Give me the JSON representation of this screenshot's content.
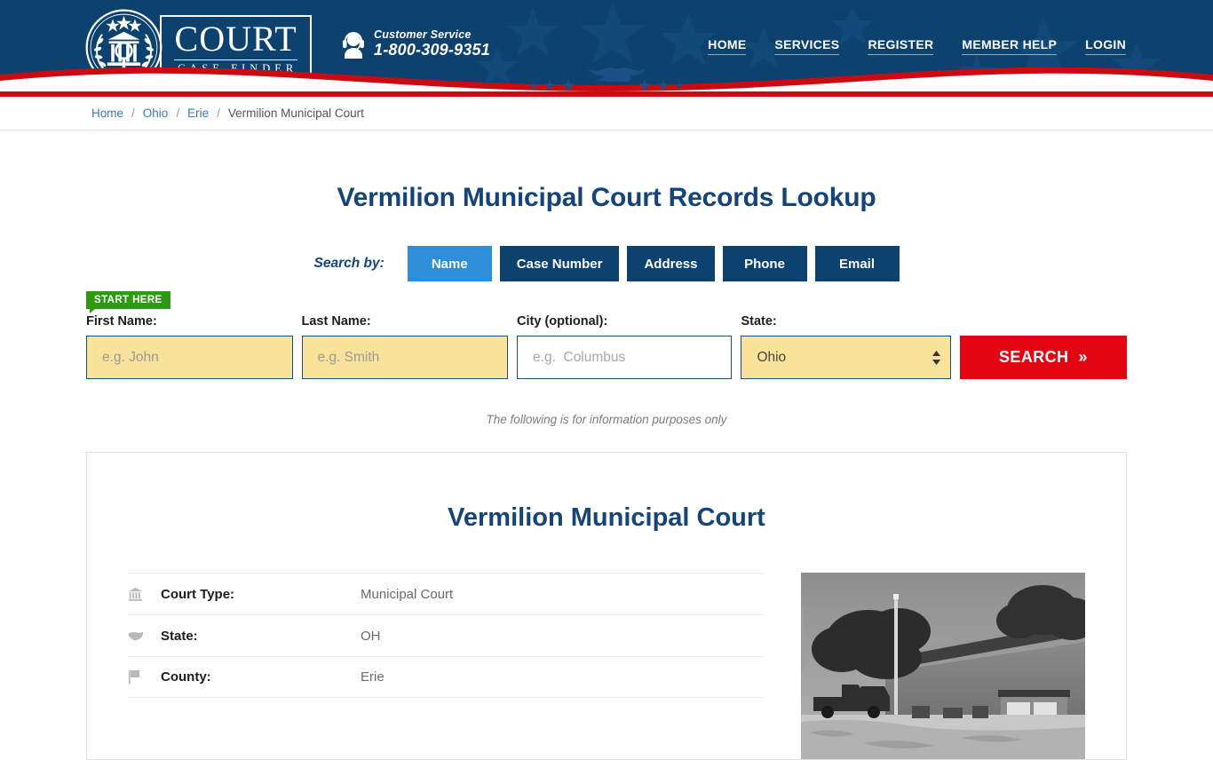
{
  "header": {
    "logo": {
      "seal_icon": "court-seal-icon",
      "title": "COURT",
      "subtitle": "CASE FINDER"
    },
    "customer_service": {
      "icon": "headset-support-icon",
      "label": "Customer Service",
      "phone": "1-800-309-9351"
    },
    "nav": [
      {
        "label": "HOME"
      },
      {
        "label": "SERVICES"
      },
      {
        "label": "REGISTER"
      },
      {
        "label": "MEMBER HELP"
      },
      {
        "label": "LOGIN"
      }
    ],
    "colors": {
      "navy": "#0d416e",
      "red": "#cc0a12",
      "accent_blue": "#2e8fd8"
    }
  },
  "breadcrumb": {
    "items": [
      {
        "label": "Home",
        "link": true
      },
      {
        "label": "Ohio",
        "link": true
      },
      {
        "label": "Erie",
        "link": true
      },
      {
        "label": "Vermilion Municipal Court",
        "link": false
      }
    ],
    "separator": "/"
  },
  "main": {
    "page_title": "Vermilion Municipal Court Records Lookup",
    "search_by_label": "Search by:",
    "tabs": [
      {
        "label": "Name",
        "active": true
      },
      {
        "label": "Case Number",
        "active": false
      },
      {
        "label": "Address",
        "active": false
      },
      {
        "label": "Phone",
        "active": false
      },
      {
        "label": "Email",
        "active": false
      }
    ],
    "start_badge": "START HERE",
    "form": {
      "first_name": {
        "label": "First Name:",
        "placeholder": "e.g. John",
        "value": ""
      },
      "last_name": {
        "label": "Last Name:",
        "placeholder": "e.g. Smith",
        "value": ""
      },
      "city": {
        "label": "City (optional):",
        "placeholder": "e.g.  Columbus",
        "value": ""
      },
      "state": {
        "label": "State:",
        "value": "Ohio",
        "options": [
          "Ohio"
        ]
      },
      "search_button": "SEARCH",
      "search_button_chevron": "»"
    },
    "disclaimer": "The following is for information purposes only"
  },
  "card": {
    "title": "Vermilion Municipal Court",
    "rows": [
      {
        "icon": "bank-building-icon",
        "key": "Court Type:",
        "value": "Municipal Court"
      },
      {
        "icon": "us-map-icon",
        "key": "State:",
        "value": "OH"
      },
      {
        "icon": "flag-icon",
        "key": "County:",
        "value": "Erie"
      }
    ],
    "photo_alt": "courthouse-photo"
  }
}
